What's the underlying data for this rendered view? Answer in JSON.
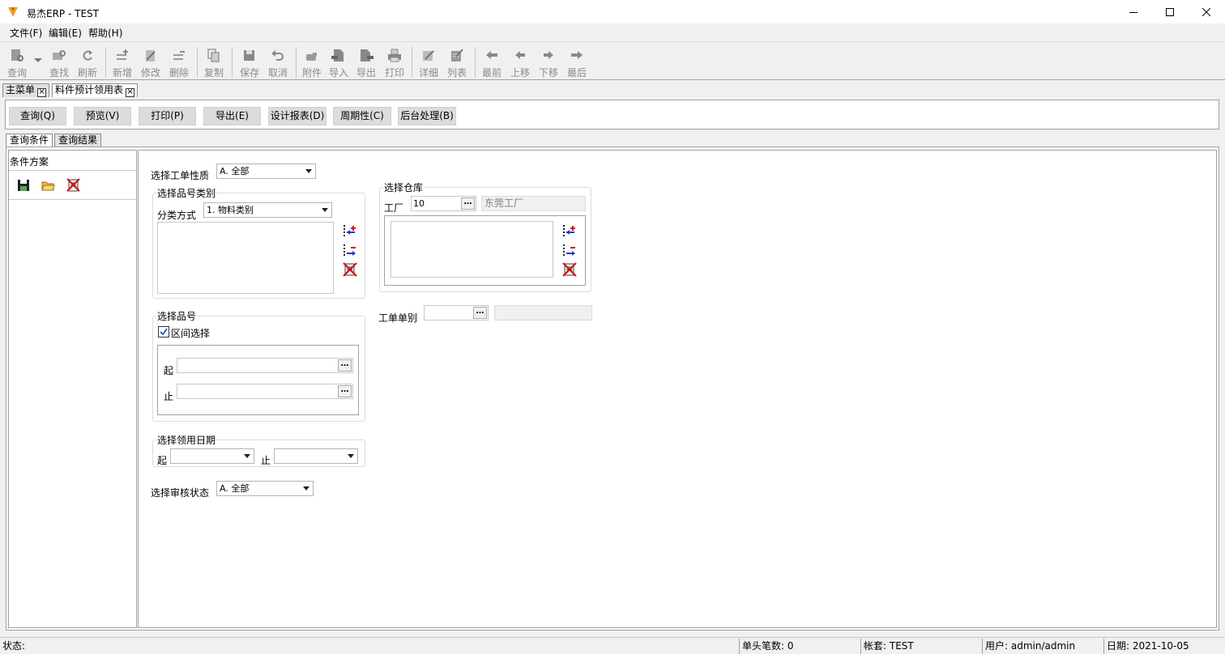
{
  "window": {
    "title": "易杰ERP - TEST"
  },
  "menu": {
    "file": "文件(F)",
    "edit": "编辑(E)",
    "help": "帮助(H)"
  },
  "toolbar": {
    "query": "查询",
    "find": "查找",
    "refresh": "刷新",
    "add": "新增",
    "modify": "修改",
    "delete": "删除",
    "copy": "复制",
    "save": "保存",
    "cancel": "取消",
    "attach": "附件",
    "import": "导入",
    "export": "导出",
    "print": "打印",
    "detail": "详细",
    "list": "列表",
    "first": "最前",
    "prev": "上移",
    "next": "下移",
    "last": "最后"
  },
  "doc_tabs": {
    "main": "主菜单",
    "report": "料件预计领用表"
  },
  "actions": {
    "query": "查询(Q)",
    "preview": "预览(V)",
    "print": "打印(P)",
    "export": "导出(E)",
    "design": "设计报表(D)",
    "periodic": "周期性(C)",
    "background": "后台处理(B)"
  },
  "sub_tabs": {
    "conditions": "查询条件",
    "results": "查询结果"
  },
  "left_panel": {
    "title": "条件方案"
  },
  "form": {
    "wo_type_label": "选择工单性质",
    "wo_type_value": "A. 全部",
    "category_group": "选择品号类别",
    "category_method_label": "分类方式",
    "category_method_value": "1. 物料类别",
    "item_group": "选择品号",
    "range_select": "区间选择",
    "from_label": "起",
    "to_label": "止",
    "date_group": "选择领用日期",
    "date_from_label": "起",
    "date_to_label": "止",
    "audit_label": "选择审核状态",
    "audit_value": "A. 全部",
    "warehouse_group": "选择仓库",
    "factory_label": "工厂",
    "factory_code": "10",
    "factory_name": "东莞工厂",
    "wo_category_label": "工单单别"
  },
  "status": {
    "state": "状态:",
    "header_count": "单头笔数: 0",
    "account": "帐套: TEST",
    "user": "用户: admin/admin",
    "date": "日期: 2021-10-05"
  }
}
